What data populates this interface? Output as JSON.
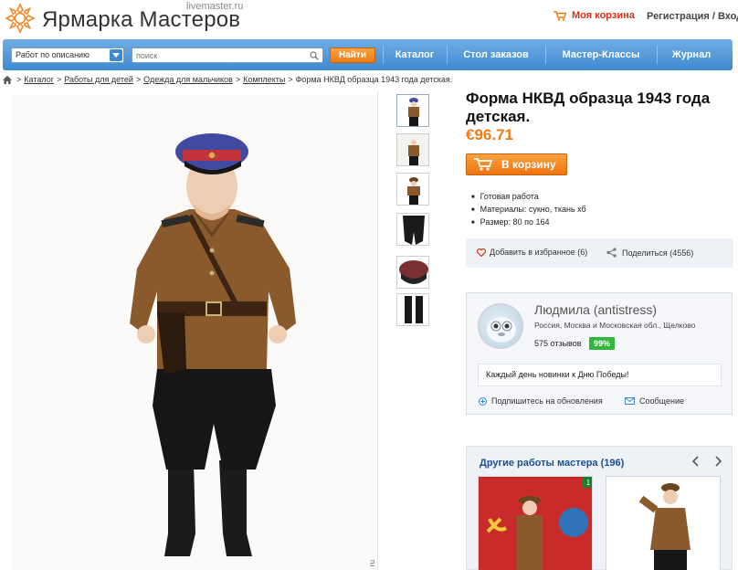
{
  "header": {
    "logo_text": "Ярмарка Мастеров",
    "logo_domain": "livemaster.ru",
    "cart_label": "Моя корзина",
    "auth_label": "Регистрация / Вход"
  },
  "nav": {
    "select_value": "Работ по описанию",
    "search_placeholder": "поиск",
    "find_label": "Найти",
    "items": [
      "Каталог",
      "Стол заказов",
      "Мастер-Классы",
      "Журнал"
    ]
  },
  "breadcrumb": {
    "items": [
      "Каталог",
      "Работы для детей",
      "Одежда для мальчиков",
      "Комплекты"
    ],
    "current": "Форма НКВД образца 1943 года детская."
  },
  "product": {
    "title": "Форма НКВД образца 1943 года детская.",
    "price": "€96.71",
    "cart_button": "В корзину",
    "features": [
      "Готовая работа",
      "Материалы: сукно, ткань хб",
      "Размер: 80 по 164"
    ],
    "favorite_label": "Добавить в избранное (6)",
    "share_label": "Поделиться (4556)",
    "photo_edge_text": "ru"
  },
  "seller": {
    "name": "Людмила (antistress)",
    "location": "Россия, Москва и Московская обл., Щелково",
    "reviews": "575 отзывов",
    "rating": "99%",
    "note": "Каждый день новинки к Дню Победы!",
    "subscribe_label": "Подпишитесь на обновления",
    "message_label": "Сообщение"
  },
  "other_works": {
    "title": "Другие работы мастера (196)",
    "badge": "1"
  },
  "colors": {
    "brand_orange": "#f07a16",
    "nav_blue": "#3f88cf",
    "rating_green": "#32b53c",
    "link_blue": "#1d4f8e"
  }
}
